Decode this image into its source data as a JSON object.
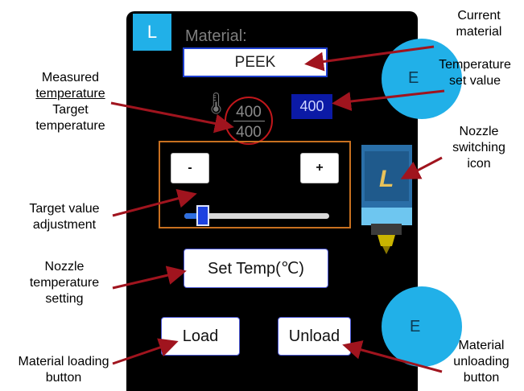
{
  "screen": {
    "nozzle_tab_label": "L",
    "material_caption": "Material:",
    "material_value": "PEEK",
    "extruder_label_top": "E",
    "extruder_label_bottom": "E",
    "measured_temperature": "400",
    "target_temperature": "400",
    "temperature_set_value": "400",
    "decrease_label": "-",
    "increase_label": "+",
    "slider_level_fraction": 0.13,
    "set_temp_label": "Set Temp(℃)",
    "load_label": "Load",
    "unload_label": "Unload",
    "nozzle_icon_letter": "L"
  },
  "annotations": {
    "current_material": [
      "Current",
      "material"
    ],
    "temperature_set_value": [
      "Temperature",
      "set value"
    ],
    "measured_target": [
      "Measured",
      "temperature",
      "Target",
      "temperature"
    ],
    "nozzle_switching": [
      "Nozzle",
      "switching",
      "icon"
    ],
    "target_adjustment": [
      "Target value",
      "adjustment"
    ],
    "nozzle_temp_setting": [
      "Nozzle",
      "temperature",
      "setting"
    ],
    "material_loading": [
      "Material loading",
      "button"
    ],
    "material_unloading": [
      "Material",
      "unloading",
      "button"
    ]
  },
  "colors": {
    "panel_bg": "#000000",
    "accent_blue": "#21b0e8",
    "callout_arrow": "#a0141e",
    "adjust_box_border": "#c87020",
    "temp_circle": "#c0171b"
  },
  "icons": [
    "thermometer-icon",
    "nozzle-switch-icon",
    "extruder-circle-icon"
  ]
}
